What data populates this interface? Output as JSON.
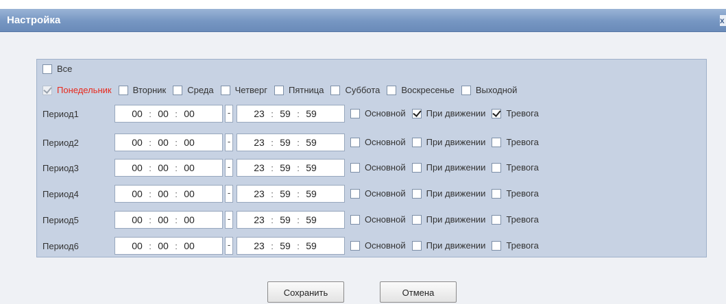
{
  "window": {
    "title": "Настройка",
    "close_glyph": "x"
  },
  "all_label": "Все",
  "days": [
    {
      "label": "Понедельник",
      "checked": true,
      "disabled": true,
      "highlight": "#e8291c"
    },
    {
      "label": "Вторник",
      "checked": false
    },
    {
      "label": "Среда",
      "checked": false
    },
    {
      "label": "Четверг",
      "checked": false
    },
    {
      "label": "Пятница",
      "checked": false
    },
    {
      "label": "Суббота",
      "checked": false
    },
    {
      "label": "Воскресенье",
      "checked": false
    },
    {
      "label": "Выходной",
      "checked": false
    }
  ],
  "time_separator": ":",
  "range_separator": "-",
  "option_labels": {
    "main": "Основной",
    "motion": "При движении",
    "alarm": "Тревога"
  },
  "periods": [
    {
      "label": "Период1",
      "start": [
        "00",
        "00",
        "00"
      ],
      "end": [
        "23",
        "59",
        "59"
      ],
      "main": false,
      "motion": true,
      "alarm": true
    },
    {
      "label": "Период2",
      "start": [
        "00",
        "00",
        "00"
      ],
      "end": [
        "23",
        "59",
        "59"
      ],
      "main": false,
      "motion": false,
      "alarm": false
    },
    {
      "label": "Период3",
      "start": [
        "00",
        "00",
        "00"
      ],
      "end": [
        "23",
        "59",
        "59"
      ],
      "main": false,
      "motion": false,
      "alarm": false
    },
    {
      "label": "Период4",
      "start": [
        "00",
        "00",
        "00"
      ],
      "end": [
        "23",
        "59",
        "59"
      ],
      "main": false,
      "motion": false,
      "alarm": false
    },
    {
      "label": "Период5",
      "start": [
        "00",
        "00",
        "00"
      ],
      "end": [
        "23",
        "59",
        "59"
      ],
      "main": false,
      "motion": false,
      "alarm": false
    },
    {
      "label": "Период6",
      "start": [
        "00",
        "00",
        "00"
      ],
      "end": [
        "23",
        "59",
        "59"
      ],
      "main": false,
      "motion": false,
      "alarm": false
    }
  ],
  "buttons": {
    "save": "Сохранить",
    "cancel": "Отмена"
  },
  "colors": {
    "titlebar": "#7696c2",
    "panel": "#c7d2e3",
    "highlight": "#e8291c"
  }
}
